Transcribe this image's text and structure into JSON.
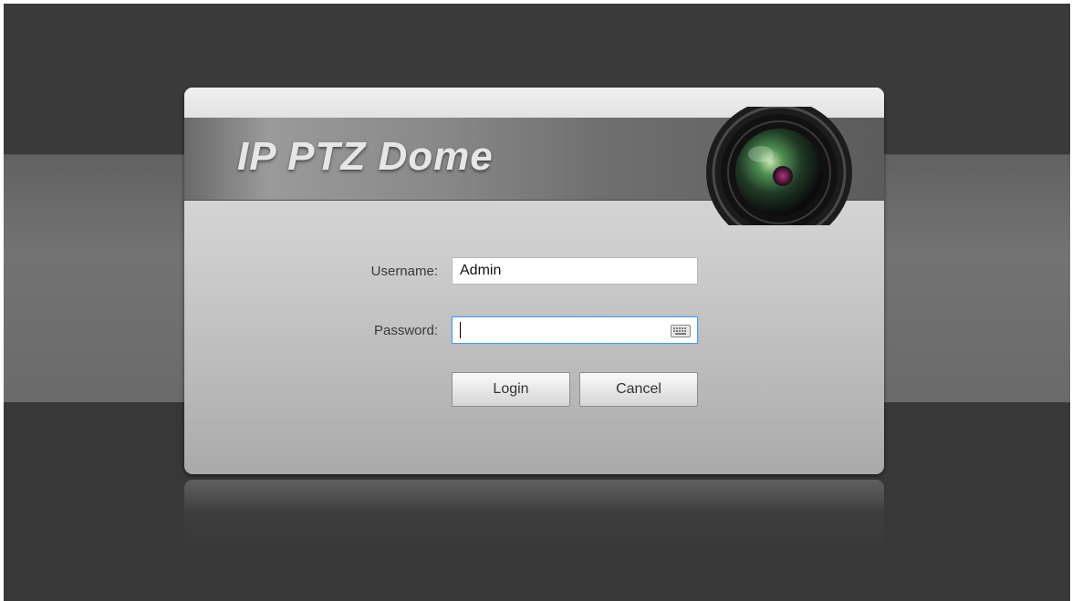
{
  "banner": {
    "title": "IP PTZ Dome"
  },
  "login_form": {
    "username_label": "Username:",
    "username_value": "Admin",
    "password_label": "Password:",
    "password_value": "",
    "login_label": "Login",
    "cancel_label": "Cancel"
  },
  "icons": {
    "lens": "camera-lens-icon",
    "keyboard": "keyboard-icon"
  },
  "colors": {
    "background": "#3a3a3a",
    "panel": "#d2d2d2",
    "focus_border": "#4a9be0"
  }
}
